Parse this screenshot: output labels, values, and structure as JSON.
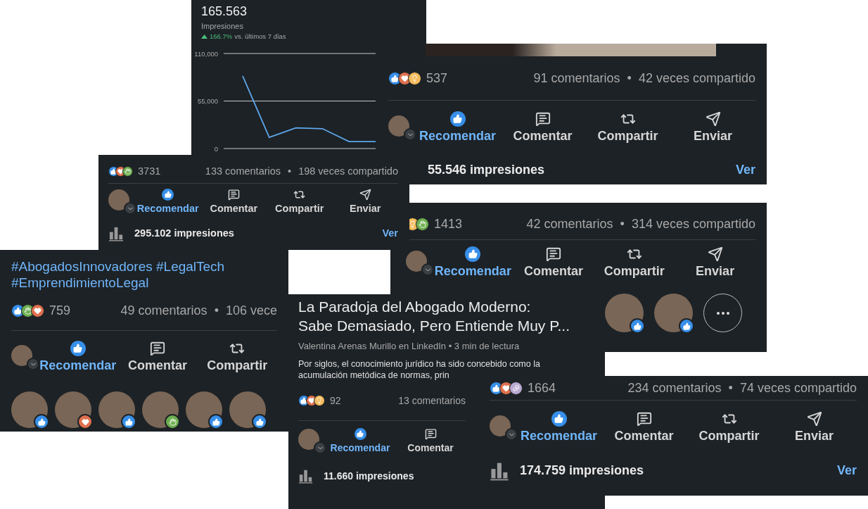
{
  "chart_card": {
    "value": "165.563",
    "label": "Impresiones",
    "rising": true,
    "change": "166.7%",
    "change_note": "vs. últimos 7 días",
    "chart_data": {
      "type": "line",
      "ylim": [
        0,
        110000
      ],
      "yticks": [
        {
          "value": 0,
          "label": "0"
        },
        {
          "value": 55000,
          "label": "55,000"
        },
        {
          "value": 110000,
          "label": "110,000"
        }
      ],
      "series": [
        {
          "color": "#5ea7ea",
          "values": [
            84000,
            13000,
            24000,
            23000,
            8000,
            8000
          ]
        }
      ]
    }
  },
  "posts": [
    {
      "photo_strip": true,
      "reactions": [
        {
          "kind": "like"
        },
        {
          "kind": "love"
        },
        {
          "kind": "insightful"
        }
      ],
      "reaction_count": "537",
      "comments": "91 comentarios",
      "separator": "•",
      "shares": "42 veces compartido",
      "actions": [
        {
          "kind": "like",
          "label": "Recomendar",
          "active": true
        },
        {
          "kind": "comment",
          "label": "Comentar",
          "active": false
        },
        {
          "kind": "share",
          "label": "Compartir",
          "active": false
        },
        {
          "kind": "send",
          "label": "Enviar",
          "active": false
        }
      ],
      "impressions": "55.546 impresiones",
      "chart_icon": false,
      "view_link": "Ver"
    },
    {
      "reactions": [
        {
          "kind": "insightful"
        },
        {
          "kind": "celebrate"
        }
      ],
      "reaction_count": "1413",
      "comments": "42 comentarios",
      "separator": "•",
      "shares": "314 veces compartido",
      "actions": [
        {
          "kind": "like",
          "label": "Recomendar",
          "active": true
        },
        {
          "kind": "comment",
          "label": "Comentar",
          "active": false
        },
        {
          "kind": "share",
          "label": "Compartir",
          "active": false
        },
        {
          "kind": "send",
          "label": "Enviar",
          "active": false
        }
      ],
      "reactors": [
        {
          "kind": "like"
        },
        {
          "kind": "like"
        }
      ],
      "more_button": true
    },
    {
      "reactions": [
        {
          "kind": "like"
        },
        {
          "kind": "love"
        },
        {
          "kind": "celebrate"
        }
      ],
      "reaction_count": "3731",
      "comments": "133 comentarios",
      "separator": "•",
      "shares": "198 veces compartido",
      "actions": [
        {
          "kind": "like",
          "label": "Recomendar",
          "active": true
        },
        {
          "kind": "comment",
          "label": "Comentar",
          "active": false
        },
        {
          "kind": "share",
          "label": "Compartir",
          "active": false
        },
        {
          "kind": "send",
          "label": "Enviar",
          "active": false
        }
      ],
      "impressions": "295.102 impresiones",
      "chart_icon": true,
      "view_link": "Ver"
    },
    {
      "hashtags": "#AbogadosInnovadores #LegalTech #EmprendimientoLegal",
      "reactions": [
        {
          "kind": "like"
        },
        {
          "kind": "celebrate"
        },
        {
          "kind": "love"
        }
      ],
      "reaction_count": "759",
      "comments": "49 comentarios",
      "separator": "•",
      "shares": "106 vece",
      "actions": [
        {
          "kind": "like",
          "label": "Recomendar",
          "active": true
        },
        {
          "kind": "comment",
          "label": "Comentar",
          "active": false
        },
        {
          "kind": "share",
          "label": "Compartir",
          "active": false
        }
      ],
      "reactors": [
        {
          "kind": "like"
        },
        {
          "kind": "love"
        },
        {
          "kind": "like"
        },
        {
          "kind": "celebrate"
        },
        {
          "kind": "like"
        },
        {
          "kind": "like"
        }
      ]
    },
    {
      "article": {
        "title_lines": [
          "La Paradoja del Abogado Moderno:",
          "Sabe Demasiado, Pero Entiende Muy P..."
        ],
        "byline": "Valentina Arenas Murillo en LinkedIn • 3 min de lectura",
        "excerpt_lines": [
          "Por siglos, el conocimiento jurídico ha sido concebido como la",
          "acumulación metódica de normas, prin"
        ]
      },
      "reactions": [
        {
          "kind": "like"
        },
        {
          "kind": "love"
        },
        {
          "kind": "insightful"
        }
      ],
      "reaction_count": "92",
      "comments": "13 comentarios",
      "actions": [
        {
          "kind": "like",
          "label": "Recomendar",
          "active": true
        },
        {
          "kind": "comment",
          "label": "Comentar",
          "active": false
        }
      ],
      "impressions": "11.660 impresiones",
      "chart_icon": true
    },
    {
      "reactions": [
        {
          "kind": "like"
        },
        {
          "kind": "love"
        },
        {
          "kind": "support"
        }
      ],
      "reaction_count": "1664",
      "comments": "234 comentarios",
      "separator": "•",
      "shares": "74 veces compartido",
      "actions": [
        {
          "kind": "like",
          "label": "Recomendar",
          "active": true
        },
        {
          "kind": "comment",
          "label": "Comentar",
          "active": false
        },
        {
          "kind": "share",
          "label": "Compartir",
          "active": false
        },
        {
          "kind": "send",
          "label": "Enviar",
          "active": false
        }
      ],
      "impressions": "174.759 impresiones",
      "chart_icon": true,
      "view_link": "Ver"
    }
  ]
}
